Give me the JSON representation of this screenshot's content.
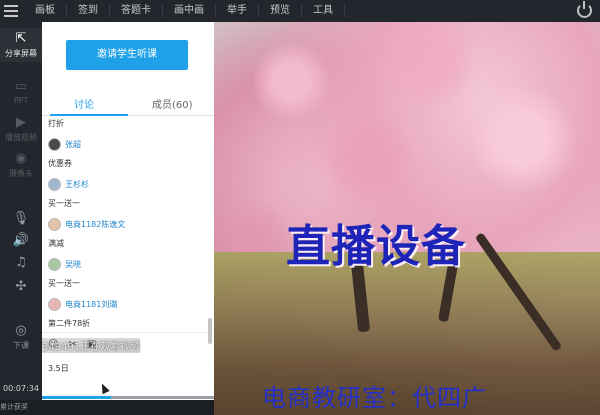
{
  "toolbar": {
    "items": [
      "画板",
      "签到",
      "答题卡",
      "画中画",
      "举手",
      "预览",
      "工具"
    ]
  },
  "rail": {
    "share_screen": "分享屏幕",
    "ppt": "PPT",
    "play_video": "播放视频",
    "camera": "摄像头",
    "end_class": "下课",
    "elapsed_time": "00:07:34",
    "live_label": "累计获奖"
  },
  "panel": {
    "invite_button": "邀请学生听课",
    "tabs": {
      "discussion": "讨论",
      "members": "成员(60)"
    },
    "feed": [
      {
        "type": "msg",
        "text": "打折"
      },
      {
        "type": "user",
        "name": "张超"
      },
      {
        "type": "msg",
        "text": "优惠券"
      },
      {
        "type": "user",
        "name": "王杉杉"
      },
      {
        "type": "msg",
        "text": "买一送一"
      },
      {
        "type": "user",
        "name": "电商1182陈逸文"
      },
      {
        "type": "msg",
        "text": "满减"
      },
      {
        "type": "user",
        "name": "吴晓"
      },
      {
        "type": "msg",
        "text": "买一送一"
      },
      {
        "type": "user",
        "name": "电商1181刘璐"
      },
      {
        "type": "msg",
        "text": "第二件78折"
      }
    ],
    "composer": {
      "emoji": "☺",
      "scissors": "✂",
      "image": "▣",
      "input_value": "3.5日"
    },
    "watching_notice": "349491正在观看视频"
  },
  "video": {
    "headline": "直播设备",
    "caption": "电商教研室：代四广"
  },
  "colors": {
    "accent": "#1ea1e8",
    "headline": "#1f24b8"
  }
}
